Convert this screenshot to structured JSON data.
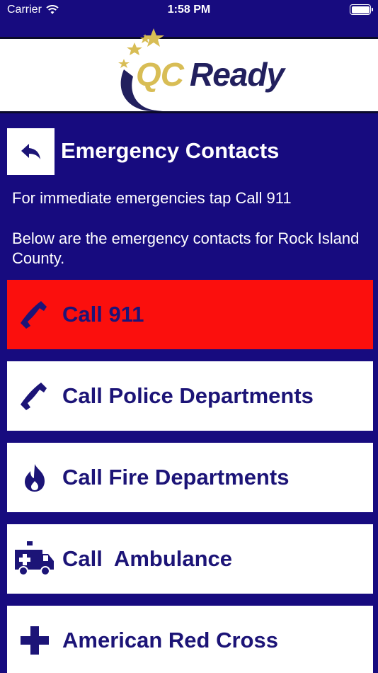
{
  "status_bar": {
    "carrier": "Carrier",
    "time": "1:58 PM"
  },
  "logo": {
    "part1": "QC",
    "part2": "Ready"
  },
  "header": {
    "title": "Emergency Contacts",
    "back_icon": "back-arrow-icon"
  },
  "intro": {
    "line1": "For immediate emergencies tap Call 911",
    "line2": "Below are the emergency contacts for Rock Island County."
  },
  "contacts": [
    {
      "label": "Call 911",
      "icon": "phone-icon",
      "color": "#fb0f0d"
    },
    {
      "label": "Call Police Departments",
      "icon": "phone-icon",
      "color": "#ffffff"
    },
    {
      "label": "Call Fire Departments",
      "icon": "fire-icon",
      "color": "#ffffff"
    },
    {
      "label": "Call  Ambulance",
      "icon": "ambulance-icon",
      "color": "#ffffff"
    },
    {
      "label": "American Red Cross",
      "icon": "plus-cross-icon",
      "color": "#ffffff"
    }
  ],
  "colors": {
    "background": "#170b7f",
    "accent_text": "#1c1477",
    "emergency": "#fb0f0d",
    "logo_gold": "#d8bd55"
  }
}
